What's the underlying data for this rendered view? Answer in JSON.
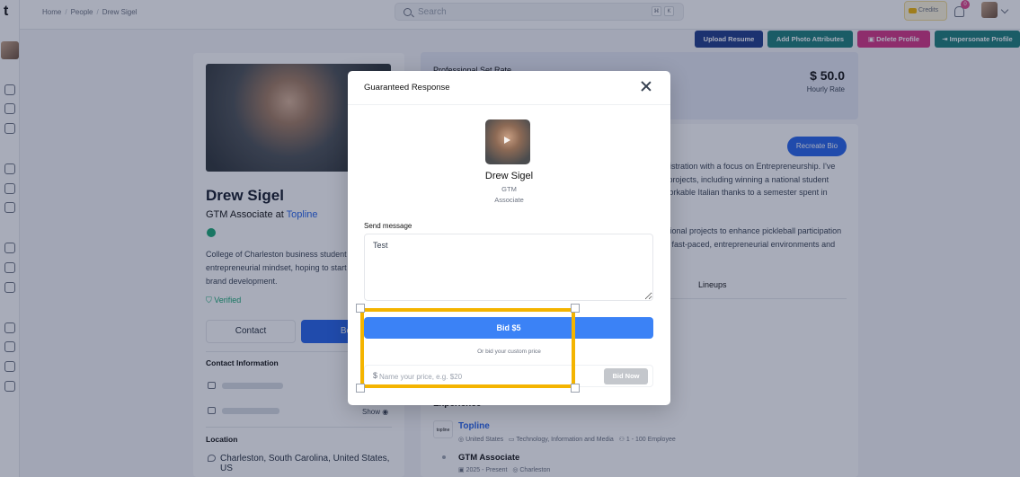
{
  "app": {
    "logo": "t"
  },
  "breadcrumb": {
    "home": "Home",
    "people": "People",
    "current": "Drew Sigel",
    "sep": "/"
  },
  "search": {
    "placeholder": "Search",
    "key1": "⌘",
    "key2": "K"
  },
  "credits": {
    "label": "Credits"
  },
  "notifications": {
    "count": "0"
  },
  "actions": {
    "upload_resume": "Upload Resume",
    "add_photo_attributes": "Add Photo Attributes",
    "delete_profile": "Delete Profile",
    "impersonate_profile": "Impersonate Profile"
  },
  "colors": {
    "primary": "#2563eb",
    "teal": "#1b7f7a",
    "navy": "#1e3a8a",
    "pink": "#d63384",
    "highlight": "#f4b400",
    "verified": "#19a974"
  },
  "profile": {
    "name": "Drew Sigel",
    "role_prefix": "GTM Associate at",
    "company": "Topline",
    "bio": "College of Charleston business student entrepreneurial mindset, hoping to start product and brand development.",
    "verified": "Verified",
    "contact_btn": "Contact",
    "book_btn": "Bo",
    "contact_info_title": "Contact Information",
    "show": "Show",
    "location_title": "Location",
    "location": "Charleston, South Carolina, United States, US"
  },
  "rate": {
    "title": "Professional Set Rate",
    "value": "$ 50.0",
    "unit": "Hourly Rate"
  },
  "about": {
    "recreate_bio": "Recreate Bio",
    "lines": [
      "inistration with a focus on Entrepreneurship. I've",
      "r projects, including winning a national student",
      "workable Italian thanks to a semester spent in",
      "ational projects to enhance pickleball participation",
      "in fast-paced, entrepreneurial environments and"
    ],
    "tab_lineups": "Lineups",
    "experience_title": "Experience"
  },
  "experience": {
    "company": "Topline",
    "logo_text": "topline",
    "location": "United States",
    "industry": "Technology, Information and Media",
    "size": "1 - 100 Employee",
    "job_title": "GTM Associate",
    "job_dates": "2025 - Present",
    "job_location": "Charleston"
  },
  "modal": {
    "title": "Guaranteed Response",
    "candidate_name": "Drew Sigel",
    "candidate_line1": "GTM",
    "candidate_line2": "Associate",
    "message_label": "Send message",
    "message_value": "Test",
    "bid_button": "Bid $5",
    "or_text": "Or bid your custom price",
    "price_symbol": "$",
    "price_placeholder": "Name your price, e.g. $20",
    "bid_now": "Bid Now"
  }
}
